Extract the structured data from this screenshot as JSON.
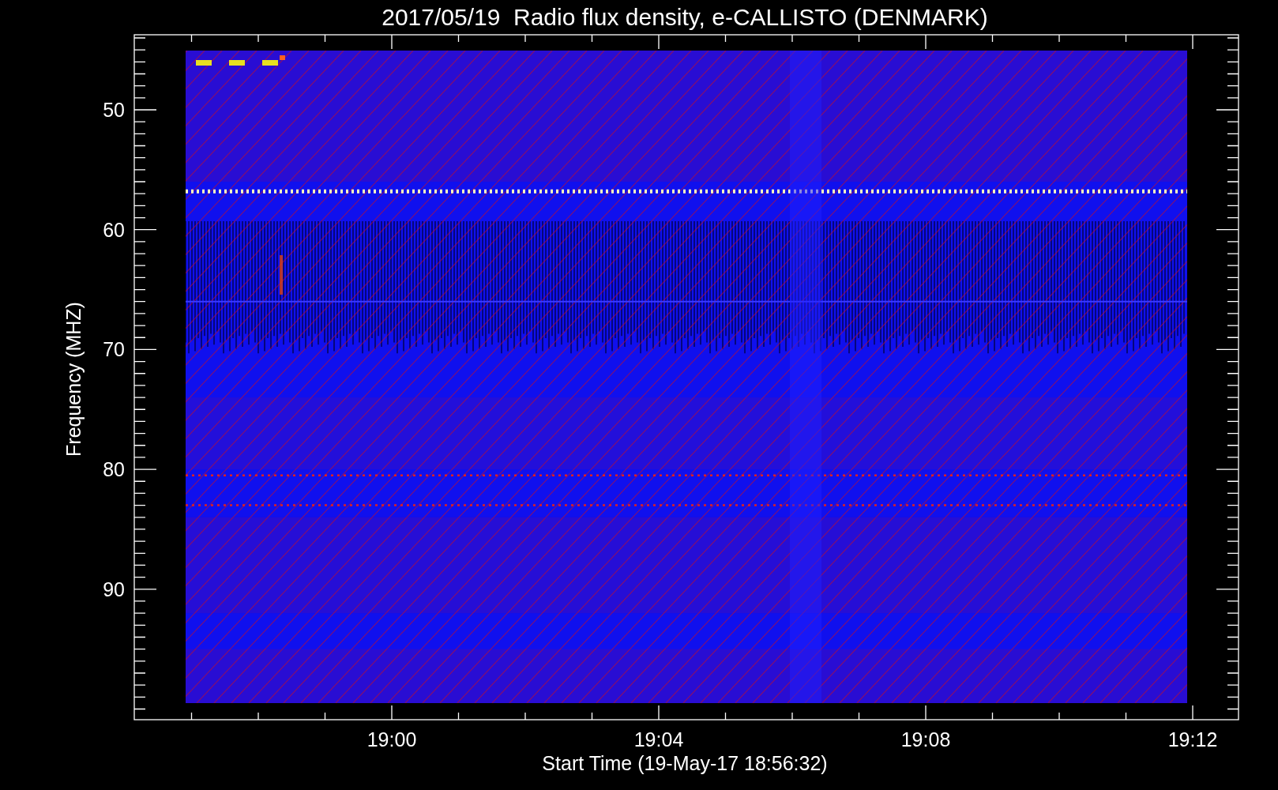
{
  "title": "2017/05/19  Radio flux density, e-CALLISTO (DENMARK)",
  "y_axis": {
    "label": "Frequency (MHZ)",
    "ticks": [
      "50",
      "60",
      "70",
      "80",
      "90"
    ]
  },
  "x_axis": {
    "label": "Start Time (19-May-17 18:56:32)",
    "ticks": [
      "19:00",
      "19:04",
      "19:08",
      "19:12"
    ]
  }
}
